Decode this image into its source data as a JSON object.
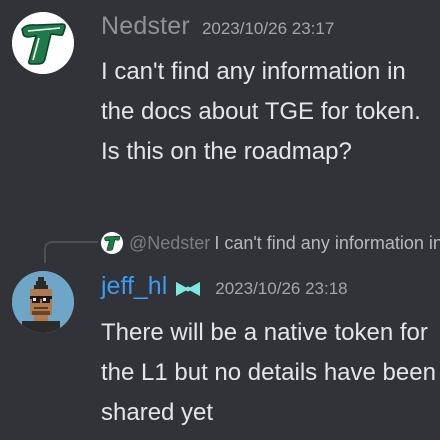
{
  "messages": [
    {
      "username": "Nedster",
      "timestamp": "2023/10/26 23:17",
      "text": "I can't find any information in the docs about TGE for token. Is this on the roadmap?",
      "avatar_icon": "tulane-t-logo-icon",
      "username_color": "#8e9297"
    },
    {
      "reply_mention": "@Nedster",
      "reply_text": "I can't find any information in the docs about TGE for token. Is this on the roadmap?",
      "username": "jeff_hl",
      "badge_icon": "bowtie-badge-icon",
      "timestamp": "2023/10/26 23:18",
      "text": "There will be a native token for the L1 but no details have been shared yet",
      "avatar_icon": "pixel-punk-avatar-icon",
      "username_color": "#3b9cf0"
    }
  ],
  "colors": {
    "background": "#313338",
    "text": "#e3e5e8",
    "muted": "#a3a6aa",
    "badge": "#7ee8e0"
  }
}
